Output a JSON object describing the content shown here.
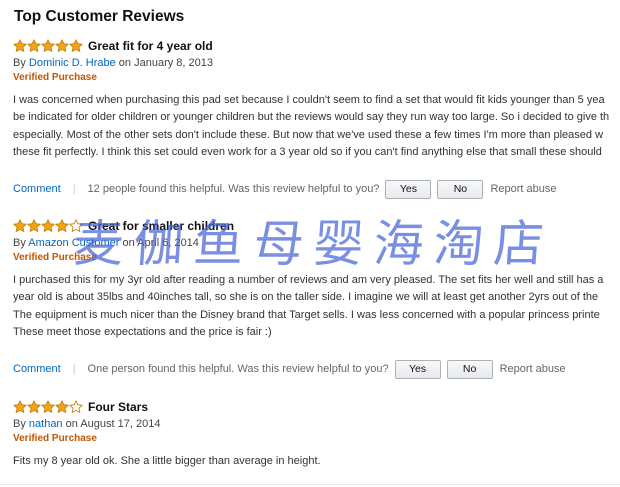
{
  "section": {
    "title": "Top Customer Reviews"
  },
  "colors": {
    "star_fill": "#f0a41b",
    "star_empty": "#ffffff",
    "link": "#0066c0",
    "verified": "#c45500",
    "watermark": "#4664d7"
  },
  "reviews": [
    {
      "rating": 5,
      "title": "Great fit for 4 year old",
      "by_prefix": "By",
      "author": "Dominic D. Hrabe",
      "date_prefix": "on",
      "date": "January 8, 2013",
      "verified": "Verified Purchase",
      "lines": [
        "I was concerned when purchasing this pad set because I couldn't seem to find a set that would fit kids younger than 5 yea",
        "be indicated for older children or younger children but the reviews would say they run way too large. So i decided to give th",
        "especially. Most of the other sets don't include these. But now that we've used these a few times I'm more than pleased w",
        "these fit perfectly. I think this set could even work for a 3 year old so if you can't find anything else that small these should"
      ],
      "comment_label": "Comment",
      "helpful_text": "12 people found this helpful. Was this review helpful to you?",
      "yes_label": "Yes",
      "no_label": "No",
      "report_label": "Report abuse"
    },
    {
      "rating": 4,
      "title": "Great for smaller children",
      "by_prefix": "By",
      "author": "Amazon Customer",
      "date_prefix": "on",
      "date": "April 6, 2014",
      "verified": "Verified Purchase",
      "lines": [
        "I purchased this for my 3yr old after reading a number of reviews and am very pleased. The set fits her well and still has a",
        "year old is about 35lbs and 40inches tall, so she is on the taller side. I imagine we will at least get another 2yrs out of the",
        "The equipment is much nicer than the Disney brand that Target sells. I was less concerned with a popular princess printe",
        "These meet those expectations and the price is fair :)"
      ],
      "comment_label": "Comment",
      "helpful_text": "One person found this helpful. Was this review helpful to you?",
      "yes_label": "Yes",
      "no_label": "No",
      "report_label": "Report abuse"
    },
    {
      "rating": 4,
      "title": "Four Stars",
      "by_prefix": "By",
      "author": "nathan",
      "date_prefix": "on",
      "date": "August 17, 2014",
      "verified": "Verified Purchase",
      "lines": [
        "Fits my 8 year old ok. She a little bigger than average in height."
      ]
    }
  ],
  "watermark": "麦伽鱼母婴海淘店"
}
